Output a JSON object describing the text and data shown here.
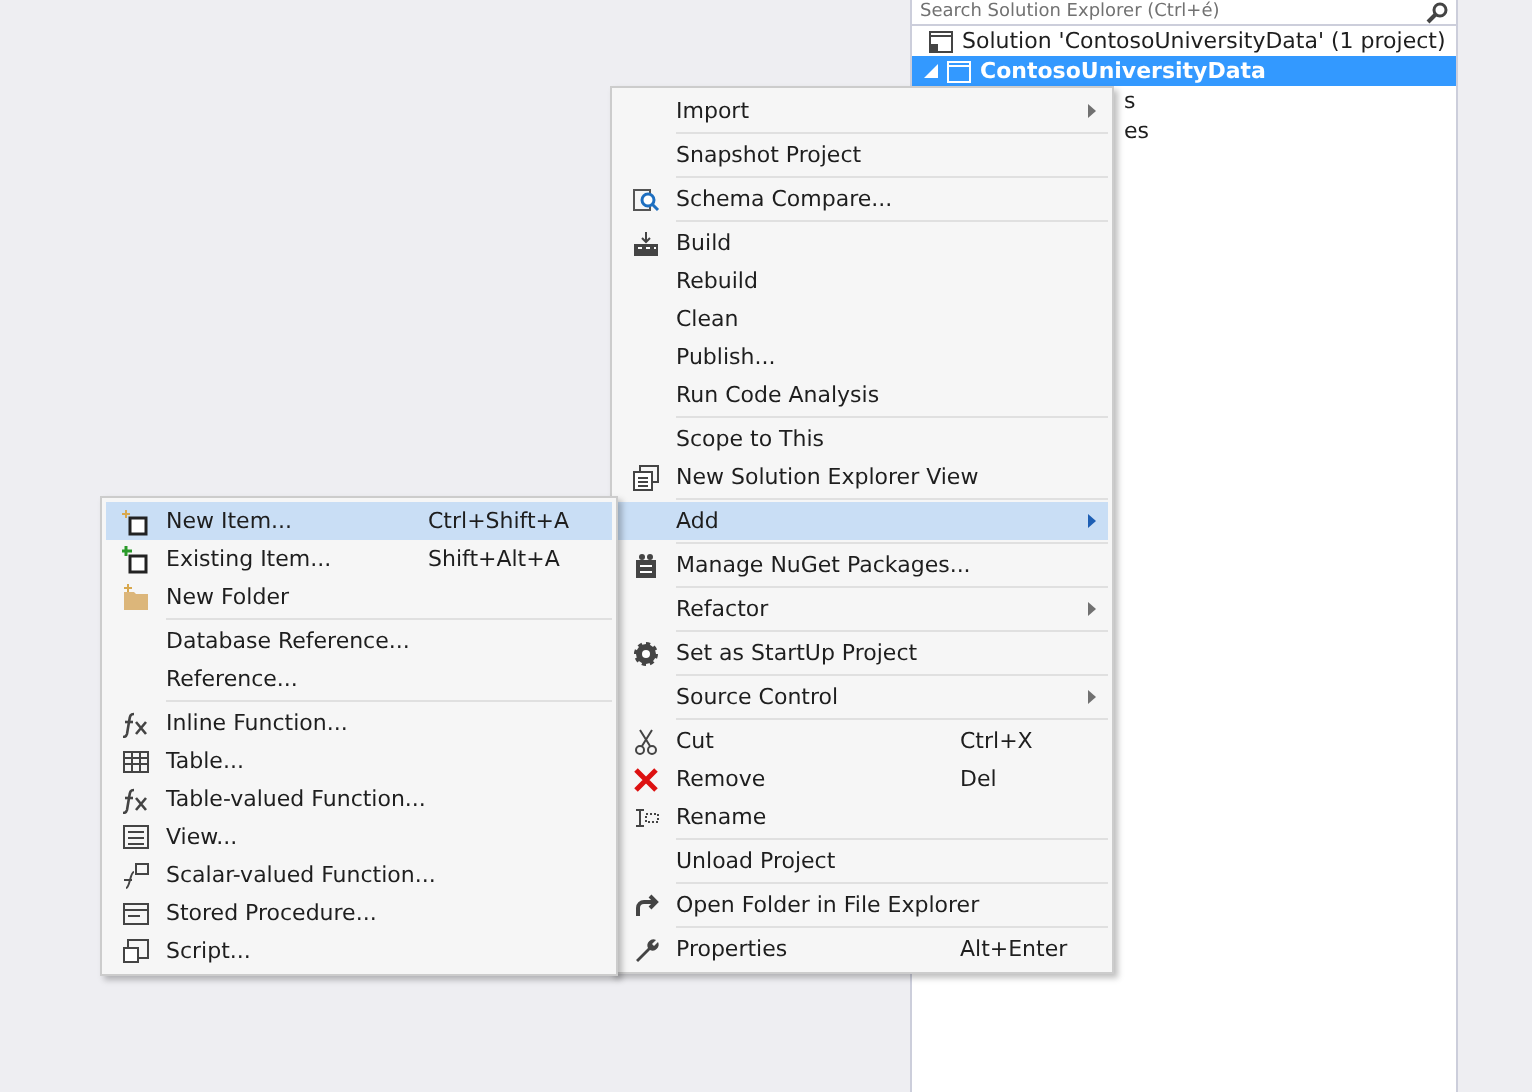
{
  "solution_explorer": {
    "search": {
      "placeholder": "Search Solution Explorer (Ctrl+é)"
    },
    "tree": [
      {
        "label": "Solution 'ContosoUniversityData' (1 project)",
        "selected": false
      },
      {
        "label": "ContosoUniversityData",
        "selected": true,
        "expanded": true,
        "children": [
          {
            "label": "s"
          },
          {
            "label": "es"
          }
        ]
      }
    ]
  },
  "context_menu": {
    "items": [
      {
        "kind": "item",
        "label": "Import",
        "submenu": true,
        "selected": false
      },
      {
        "kind": "separator"
      },
      {
        "kind": "item",
        "label": "Snapshot Project",
        "selected": false
      },
      {
        "kind": "separator"
      },
      {
        "kind": "item",
        "label": "Schema Compare...",
        "selected": false
      },
      {
        "kind": "separator"
      },
      {
        "kind": "item",
        "label": "Build",
        "selected": false
      },
      {
        "kind": "item",
        "label": "Rebuild",
        "selected": false
      },
      {
        "kind": "item",
        "label": "Clean",
        "selected": false
      },
      {
        "kind": "item",
        "label": "Publish...",
        "selected": false
      },
      {
        "kind": "item",
        "label": "Run Code Analysis",
        "selected": false
      },
      {
        "kind": "separator"
      },
      {
        "kind": "item",
        "label": "Scope to This",
        "selected": false
      },
      {
        "kind": "item",
        "label": "New Solution Explorer View",
        "selected": false
      },
      {
        "kind": "separator"
      },
      {
        "kind": "item",
        "label": "Add",
        "submenu": true,
        "selected": true
      },
      {
        "kind": "separator"
      },
      {
        "kind": "item",
        "label": "Manage NuGet Packages...",
        "selected": false
      },
      {
        "kind": "separator"
      },
      {
        "kind": "item",
        "label": "Refactor",
        "submenu": true,
        "selected": false
      },
      {
        "kind": "separator"
      },
      {
        "kind": "item",
        "label": "Set as StartUp Project",
        "selected": false
      },
      {
        "kind": "separator"
      },
      {
        "kind": "item",
        "label": "Source Control",
        "submenu": true,
        "selected": false
      },
      {
        "kind": "separator"
      },
      {
        "kind": "item",
        "label": "Cut",
        "shortcut": "Ctrl+X",
        "selected": false
      },
      {
        "kind": "item",
        "label": "Remove",
        "shortcut": "Del",
        "selected": false
      },
      {
        "kind": "item",
        "label": "Rename",
        "selected": false
      },
      {
        "kind": "separator"
      },
      {
        "kind": "item",
        "label": "Unload Project",
        "selected": false
      },
      {
        "kind": "separator"
      },
      {
        "kind": "item",
        "label": "Open Folder in File Explorer",
        "selected": false
      },
      {
        "kind": "separator"
      },
      {
        "kind": "item",
        "label": "Properties",
        "shortcut": "Alt+Enter",
        "selected": false
      }
    ]
  },
  "add_submenu": {
    "items": [
      {
        "kind": "item",
        "label": "New Item...",
        "shortcut": "Ctrl+Shift+A",
        "selected": true
      },
      {
        "kind": "item",
        "label": "Existing Item...",
        "shortcut": "Shift+Alt+A",
        "selected": false
      },
      {
        "kind": "item",
        "label": "New Folder",
        "selected": false
      },
      {
        "kind": "separator"
      },
      {
        "kind": "item",
        "label": "Database Reference...",
        "selected": false
      },
      {
        "kind": "item",
        "label": "Reference...",
        "selected": false
      },
      {
        "kind": "separator"
      },
      {
        "kind": "item",
        "label": "Inline Function...",
        "selected": false
      },
      {
        "kind": "item",
        "label": "Table...",
        "selected": false
      },
      {
        "kind": "item",
        "label": "Table-valued Function...",
        "selected": false
      },
      {
        "kind": "item",
        "label": "View...",
        "selected": false
      },
      {
        "kind": "item",
        "label": "Scalar-valued Function...",
        "selected": false
      },
      {
        "kind": "item",
        "label": "Stored Procedure...",
        "selected": false
      },
      {
        "kind": "item",
        "label": "Script...",
        "selected": false
      }
    ]
  }
}
